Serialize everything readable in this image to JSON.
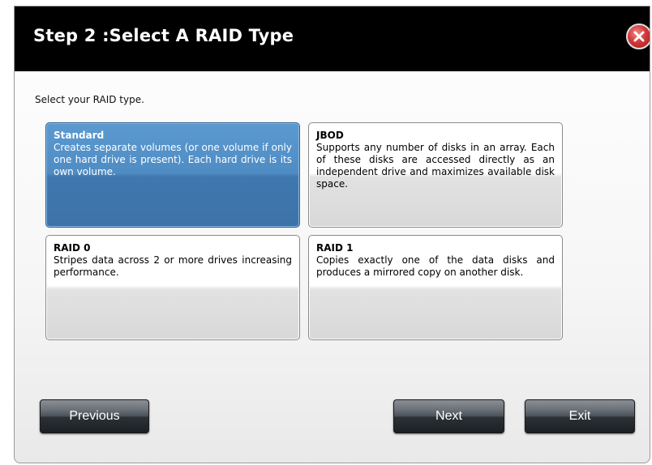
{
  "dialog": {
    "title": "Step 2 :Select A RAID Type",
    "instruction": "Select your RAID type."
  },
  "options": [
    {
      "title": "Standard",
      "description": "Creates separate volumes (or one volume if only one hard drive is present). Each hard drive is its own volume.",
      "selected": true
    },
    {
      "title": "JBOD",
      "description": "Supports any number of disks in an array. Each of these disks are accessed directly as an independent drive and maximizes available disk space.",
      "selected": false
    },
    {
      "title": "RAID 0",
      "description": "Stripes data across 2 or more drives increasing performance.",
      "selected": false
    },
    {
      "title": "RAID 1",
      "description": "Copies exactly one of the data disks and produces a mirrored copy on another disk.",
      "selected": false
    }
  ],
  "buttons": {
    "previous": "Previous",
    "next": "Next",
    "exit": "Exit"
  },
  "icons": {
    "close": "close-icon"
  },
  "colors": {
    "titlebar": "#000000",
    "selected_option": "#4f8cc4",
    "close_button": "#d23a3a"
  }
}
